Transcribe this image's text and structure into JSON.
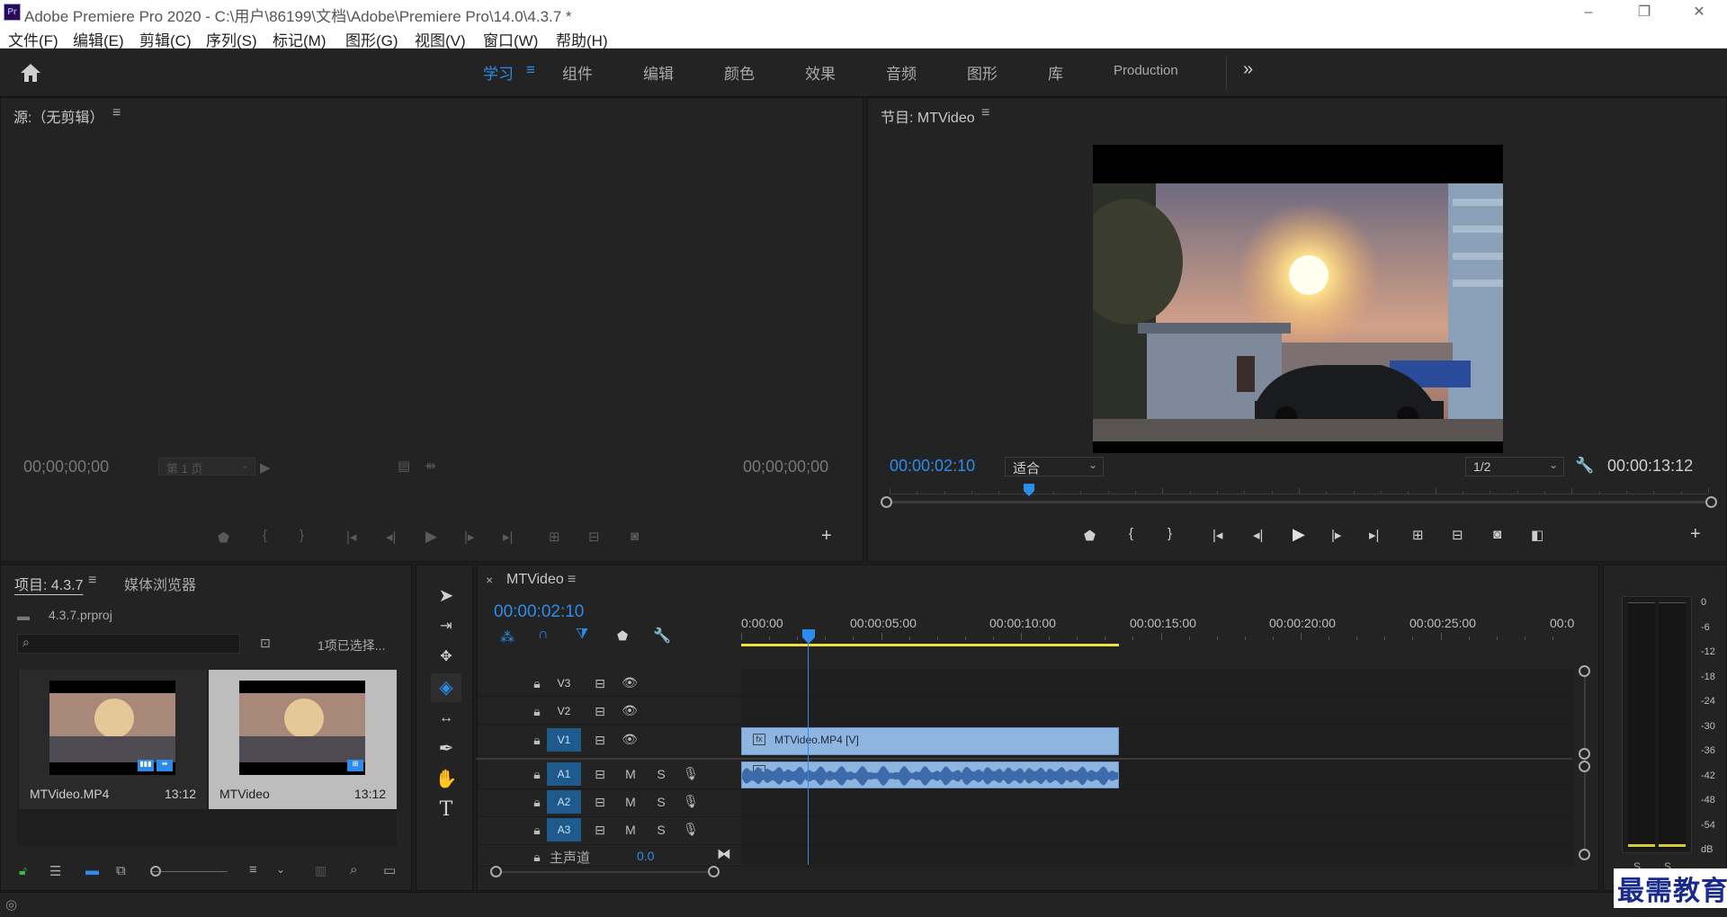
{
  "window": {
    "title": "Adobe Premiere Pro 2020 - C:\\用户\\86199\\文档\\Adobe\\Premiere Pro\\14.0\\4.3.7 *",
    "app_logo": "Pr",
    "controls": [
      "–",
      "❐",
      "✕"
    ]
  },
  "menu": [
    "文件(F)",
    "编辑(E)",
    "剪辑(C)",
    "序列(S)",
    "标记(M)",
    "图形(G)",
    "视图(V)",
    "窗口(W)",
    "帮助(H)"
  ],
  "workspaces": {
    "tabs": [
      "学习",
      "组件",
      "编辑",
      "颜色",
      "效果",
      "音频",
      "图形",
      "库",
      "Production"
    ],
    "active": "学习",
    "more_icon": "»"
  },
  "source_monitor": {
    "title": "源:（无剪辑）",
    "timecode_left": "00;00;00;00",
    "timecode_right": "00;00;00;00",
    "page_select": "第 1 页"
  },
  "program_monitor": {
    "title": "节目: MTVideo",
    "timecode": "00:00:02:10",
    "fit": "适合",
    "resolution": "1/2",
    "duration": "00:00:13:12",
    "playhead_fraction": 0.17
  },
  "project": {
    "tab_project": "项目: 4.3.7",
    "tab_media": "媒体浏览器",
    "file": "4.3.7.prproj",
    "selection": "1项已选择...",
    "items": [
      {
        "name": "MTVideo.MP4",
        "duration": "13:12"
      },
      {
        "name": "MTVideo",
        "duration": "13:12"
      }
    ]
  },
  "timeline": {
    "tab": "MTVideo",
    "timecode": "00:00:02:10",
    "ruler": [
      "0:00:00",
      "00:00:05:00",
      "00:00:10:00",
      "00:00:15:00",
      "00:00:20:00",
      "00:00:25:00",
      "00:0"
    ],
    "video_tracks": [
      "V3",
      "V2",
      "V1"
    ],
    "audio_tracks": [
      "A1",
      "A2",
      "A3"
    ],
    "track_m": "M",
    "track_s": "S",
    "master": "主声道",
    "master_value": "0.0",
    "clip_video_label": "MTVideo.MP4 [V]",
    "clip_start_sec": 0,
    "clip_end_sec": 13.5,
    "playhead_sec": 2.4
  },
  "meter": {
    "scale": [
      "0",
      "-6",
      "-12",
      "-18",
      "-24",
      "-30",
      "-36",
      "-42",
      "-48",
      "-54",
      "dB"
    ],
    "channels": [
      "S",
      "S"
    ]
  },
  "watermark": "最需教育"
}
